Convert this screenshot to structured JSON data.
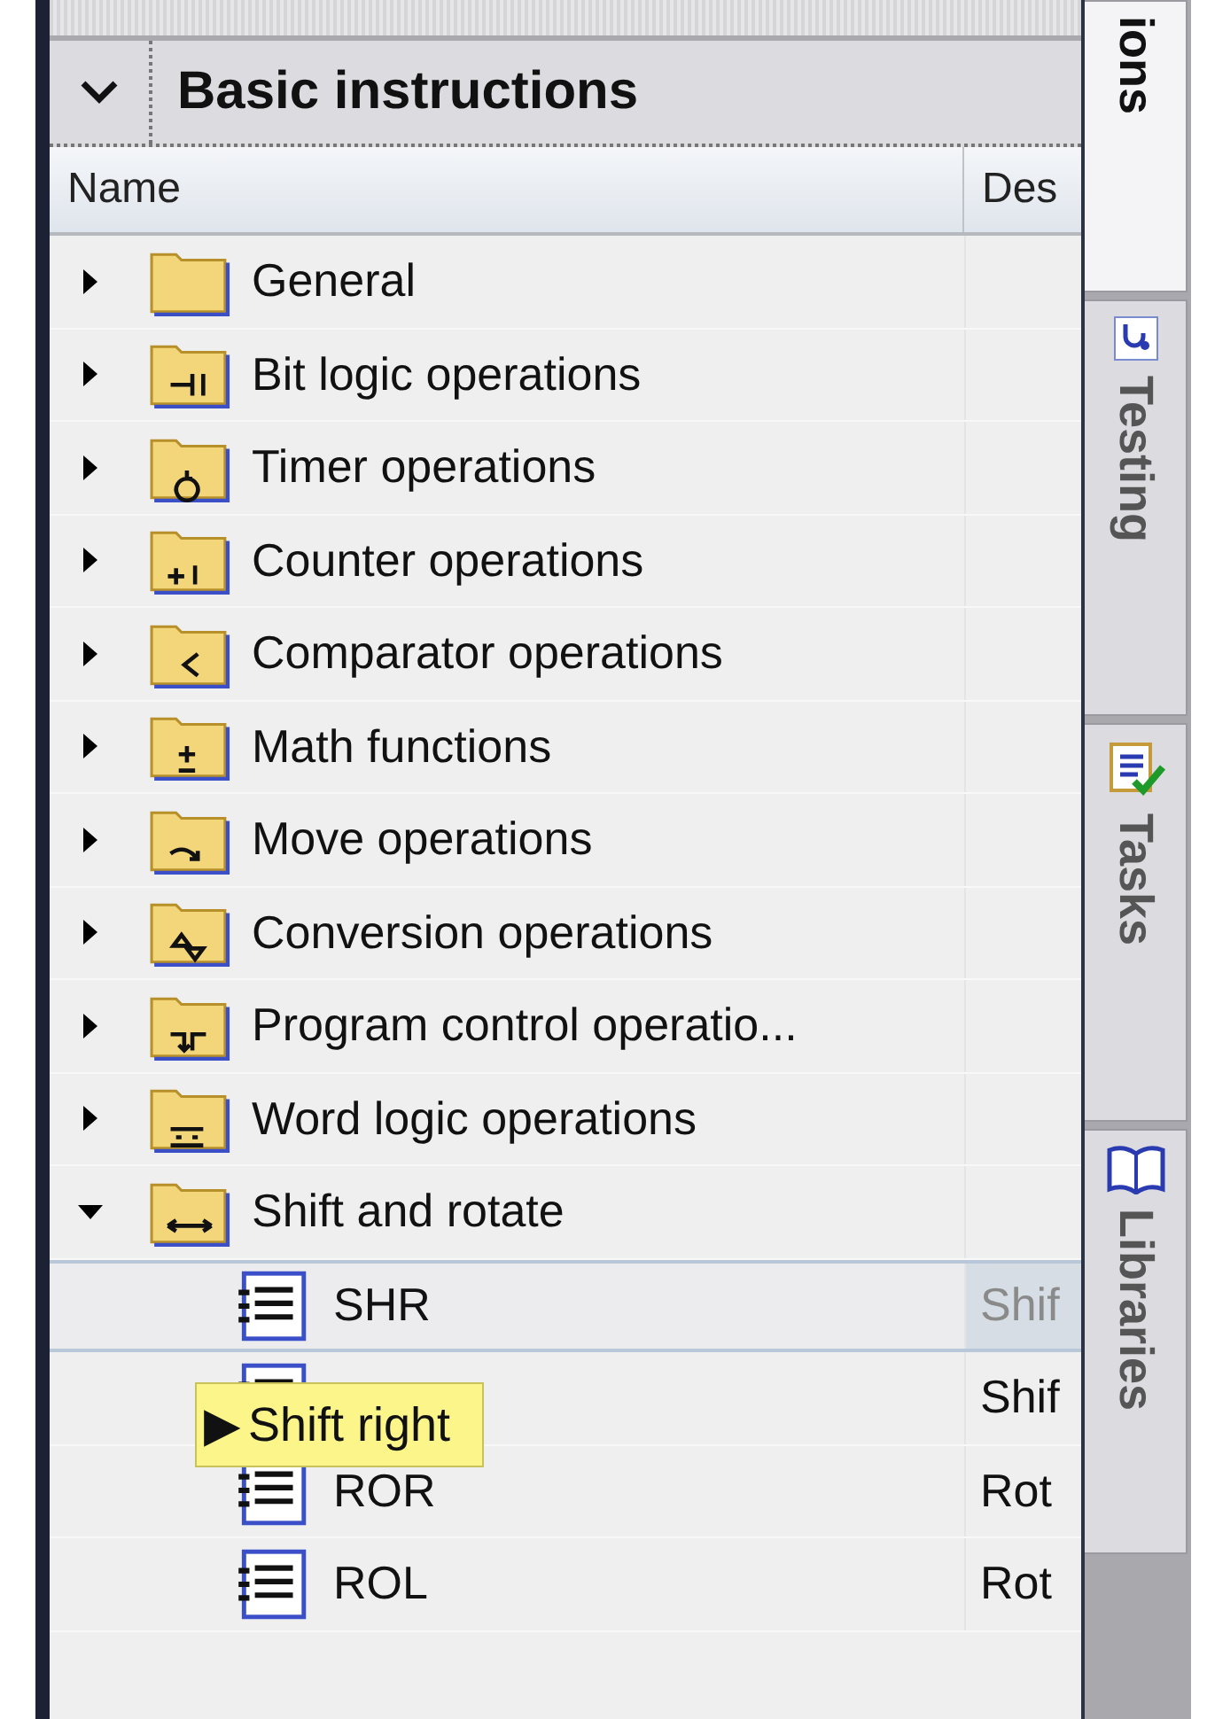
{
  "panel": {
    "title": "Basic instructions",
    "expanded": true
  },
  "columns": [
    "Name",
    "Des"
  ],
  "tree": [
    {
      "name": "General",
      "expanded": false
    },
    {
      "name": "Bit logic operations",
      "expanded": false
    },
    {
      "name": "Timer operations",
      "expanded": false
    },
    {
      "name": "Counter operations",
      "expanded": false
    },
    {
      "name": "Comparator operations",
      "expanded": false
    },
    {
      "name": "Math functions",
      "expanded": false
    },
    {
      "name": "Move operations",
      "expanded": false
    },
    {
      "name": "Conversion operations",
      "expanded": false
    },
    {
      "name": "Program control operatio...",
      "expanded": false
    },
    {
      "name": "Word logic operations",
      "expanded": false
    },
    {
      "name": "Shift and rotate",
      "expanded": true,
      "children": [
        {
          "name": "SHR",
          "description": "Shif",
          "selected": true
        },
        {
          "description": "Shif",
          "selected": false
        },
        {
          "name": "ROR",
          "description": "Rot",
          "selected": false
        },
        {
          "name": "ROL",
          "description": "Rot",
          "selected": false
        }
      ]
    }
  ],
  "tooltip": {
    "marker": "▶",
    "text": "Shift right"
  },
  "side_tabs": [
    {
      "label": "ions",
      "selected": true
    },
    {
      "label": "Testing",
      "selected": false
    },
    {
      "label": "Tasks",
      "selected": false
    },
    {
      "label": "Libraries",
      "selected": false
    }
  ]
}
